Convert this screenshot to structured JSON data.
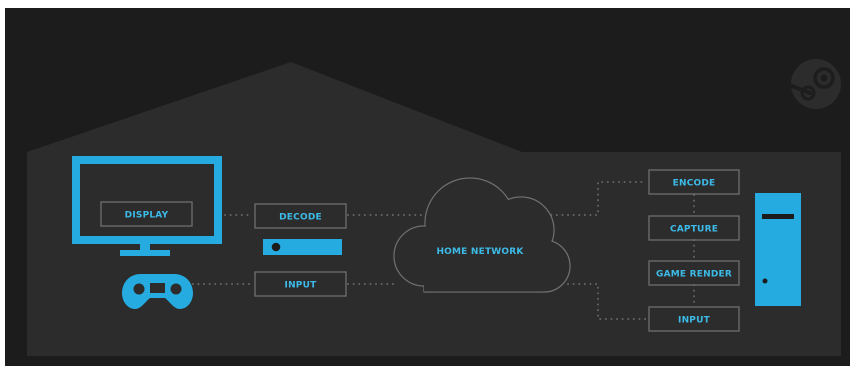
{
  "colors": {
    "background": "#1c1c1c",
    "house": "#2c2c2c",
    "accent": "#25abe0",
    "box_stroke": "#6f6f6f",
    "connector_dots": "#646464",
    "label_text": "#3dbbe8"
  },
  "icons": {
    "tv": "tv-monitor-icon",
    "streaming_box": "set-top-box-icon",
    "gamepad": "gamepad-icon",
    "tower": "pc-tower-icon",
    "cloud": "cloud-icon",
    "logo": "steam-logo-icon"
  },
  "client_side": {
    "display_label": "DISPLAY",
    "decode_label": "DECODE",
    "input_label": "INPUT"
  },
  "network": {
    "label": "HOME NETWORK"
  },
  "host_side": {
    "encode_label": "ENCODE",
    "capture_label": "CAPTURE",
    "game_render_label": "GAME RENDER",
    "input_label": "INPUT"
  }
}
